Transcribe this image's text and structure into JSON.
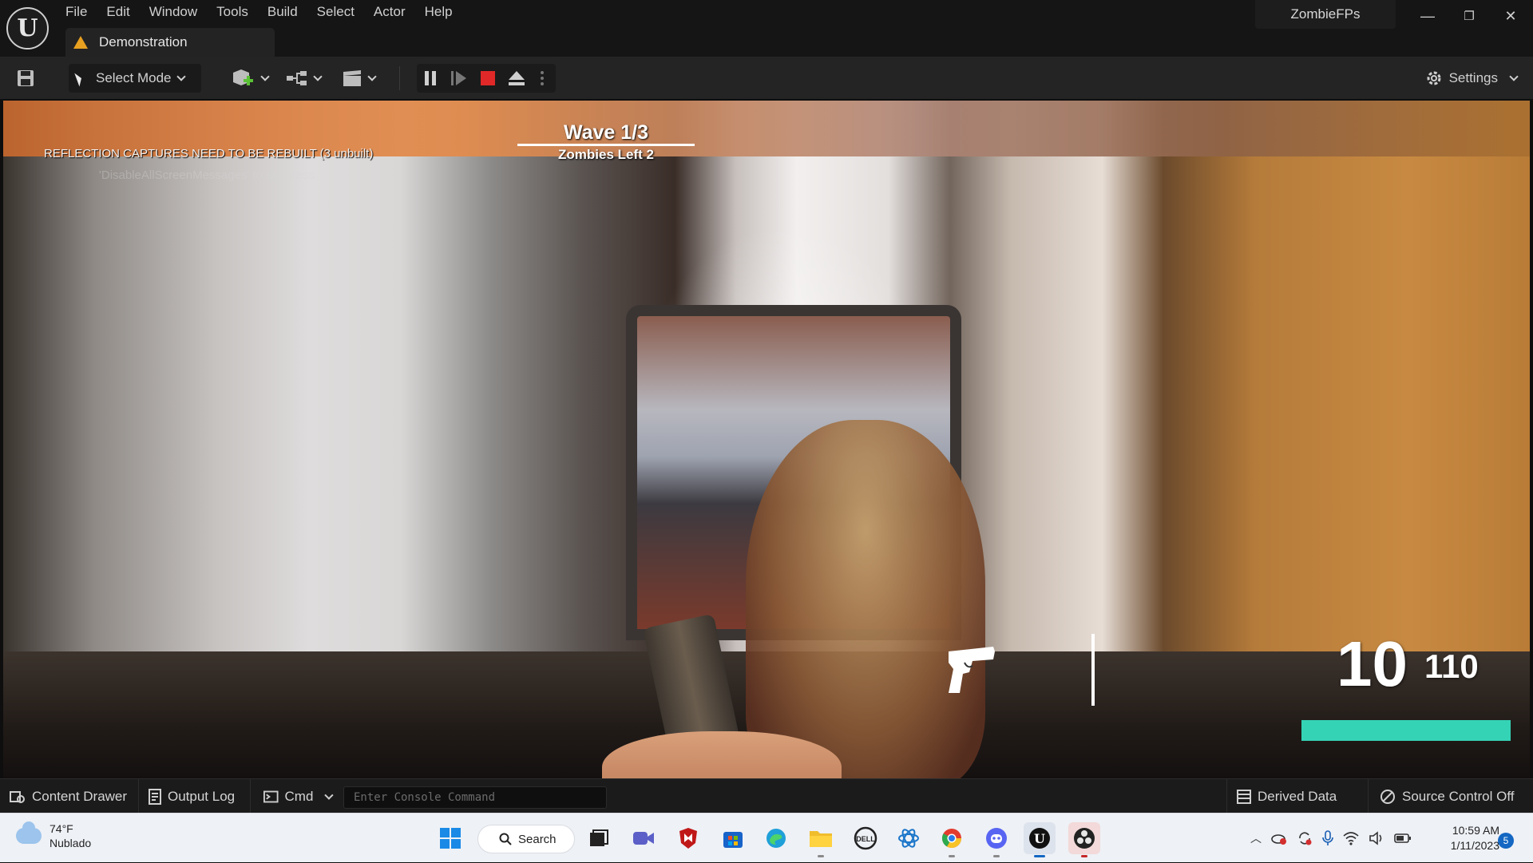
{
  "menu": {
    "items": [
      "File",
      "Edit",
      "Window",
      "Tools",
      "Build",
      "Select",
      "Actor",
      "Help"
    ]
  },
  "level_tab": {
    "label": "Demonstration",
    "icon": "warning-icon"
  },
  "project": {
    "name": "ZombieFPs"
  },
  "window_controls": {
    "minimize": "—",
    "restore": "❐",
    "close": "✕"
  },
  "toolbar": {
    "mode_label": "Select Mode",
    "settings_label": "Settings",
    "accent_play_stop": "#e02828"
  },
  "viewport": {
    "message_reflection": "REFLECTION CAPTURES NEED TO BE REBUILT (3 unbuilt)",
    "message_suppress": "'DisableAllScreenMessages' to suppress"
  },
  "hud": {
    "wave": "Wave 1/3",
    "zombies_left": "Zombies Left 2",
    "ammo_clip": "10",
    "ammo_reserve": "110",
    "health_fraction": 1.0,
    "health_color": "#35d3b6"
  },
  "bottom_bar": {
    "content_drawer": "Content Drawer",
    "output_log": "Output Log",
    "cmd": "Cmd",
    "console_placeholder": "Enter Console Command",
    "derived_data": "Derived Data",
    "source_control": "Source Control Off"
  },
  "taskbar": {
    "weather_temp": "74°F",
    "weather_desc": "Nublado",
    "search_label": "Search",
    "clock_time": "10:59 AM",
    "clock_date": "1/11/2023",
    "notification_count": "5"
  }
}
